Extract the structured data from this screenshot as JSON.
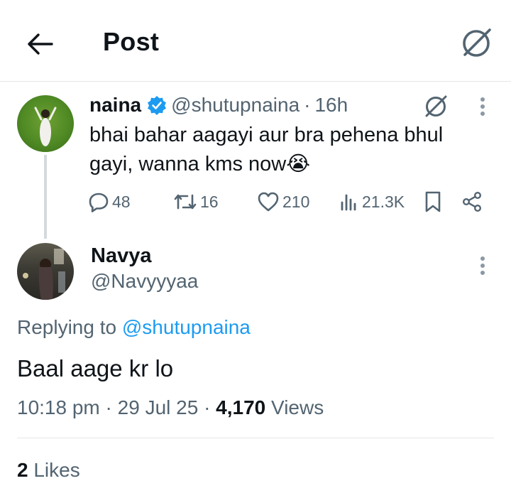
{
  "header": {
    "title": "Post",
    "back_icon": "back-arrow-icon",
    "grok_icon": "grok-icon"
  },
  "original_post": {
    "name": "naina",
    "handle": "@shutupnaina",
    "separator": "·",
    "time": "16h",
    "text": "bhai bahar aagayi aur bra pehena bhul gayi, wanna kms now😭",
    "replies": "48",
    "reposts": "16",
    "likes": "210",
    "views": "21.3K"
  },
  "reply_post": {
    "name": "Navya",
    "handle": "@Navyyyaa",
    "replying_prefix": "Replying to",
    "replying_to": "@shutupnaina",
    "text": "Baal aage kr lo",
    "time": "10:18 pm",
    "date": "29 Jul 25",
    "views_count": "4,170",
    "views_label": "Views",
    "likes_count": "2",
    "likes_label": "Likes"
  },
  "colors": {
    "accent": "#1d9bf0",
    "muted": "#536471",
    "text": "#0f1419",
    "divider": "#e6e6e6"
  }
}
